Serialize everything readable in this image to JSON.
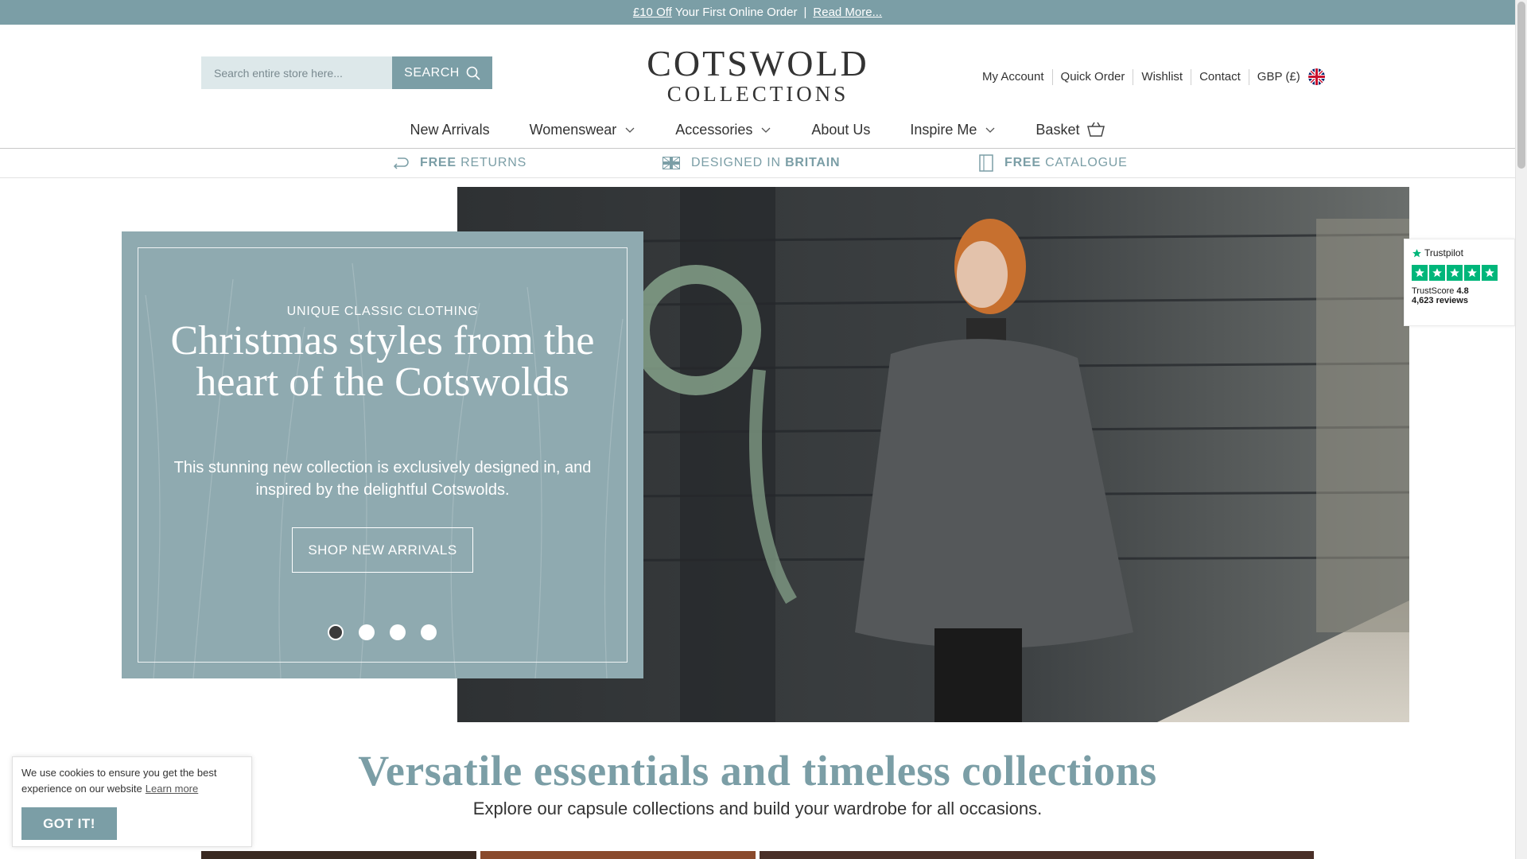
{
  "promo": {
    "link": "£10 Off",
    "text": "Your First Online Order",
    "separator": "|",
    "read_more": "Read More..."
  },
  "header": {
    "search_placeholder": "Search entire store here...",
    "search_button": "SEARCH",
    "logo_line1": "COTSWOLD",
    "logo_line2": "COLLECTIONS",
    "links": [
      "My Account",
      "Quick Order",
      "Wishlist",
      "Contact"
    ],
    "currency": "GBP (£)"
  },
  "nav": {
    "items": [
      {
        "label": "New Arrivals",
        "dropdown": false
      },
      {
        "label": "Womenswear",
        "dropdown": true
      },
      {
        "label": "Accessories",
        "dropdown": true
      },
      {
        "label": "About Us",
        "dropdown": false
      },
      {
        "label": "Inspire Me",
        "dropdown": true
      },
      {
        "label": "Basket",
        "dropdown": false
      }
    ]
  },
  "usps": [
    {
      "bold": "FREE",
      "text": "RETURNS",
      "icon": "return-arrow-icon"
    },
    {
      "bold": "BRITAIN",
      "text": "DESIGNED IN",
      "icon": "union-flag-icon"
    },
    {
      "bold": "FREE",
      "text": "CATALOGUE",
      "icon": "catalogue-icon"
    }
  ],
  "hero": {
    "eyebrow": "UNIQUE CLASSIC CLOTHING",
    "title": "Christmas styles from the heart of the Cotswolds",
    "text": "This stunning new collection is exclusively designed in, and inspired by the delightful Cotswolds.",
    "button": "SHOP NEW ARRIVALS",
    "slides": 4,
    "active_slide": 1
  },
  "trustpilot": {
    "brand": "Trustpilot",
    "score_label": "TrustScore",
    "score": "4.8",
    "reviews": "4,623 reviews",
    "stars": 5
  },
  "section": {
    "title": "Versatile essentials and timeless collections",
    "subtitle": "Explore our capsule collections and build your wardrobe for all occasions."
  },
  "cookie": {
    "text": "We use cookies to ensure you get the best experience on our website",
    "learn_more": "Learn more",
    "button": "GOT IT!"
  },
  "colors": {
    "accent": "#7b9ea6",
    "panel": "#8faab0",
    "trustpilot_green": "#00b67a"
  }
}
